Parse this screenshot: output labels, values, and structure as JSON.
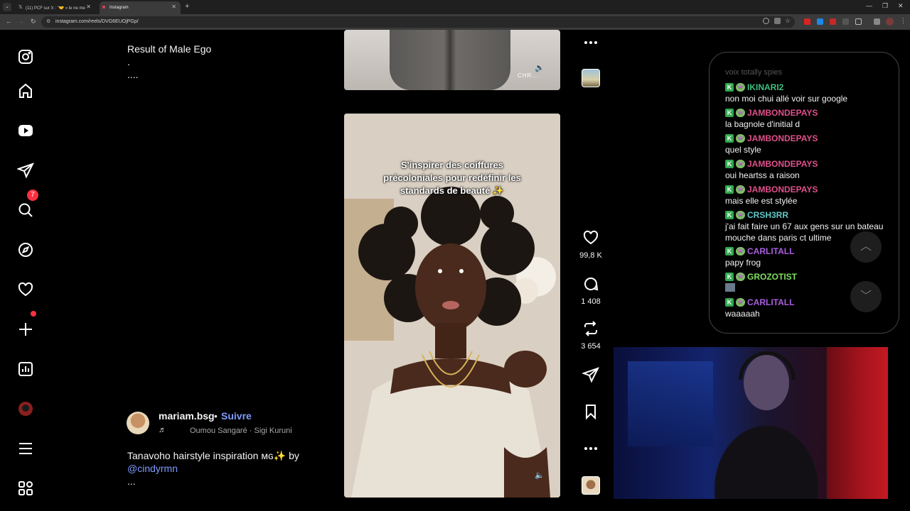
{
  "browser": {
    "tabs": [
      {
        "title": "(11) PCF sur X : \"🤝 « le ne me",
        "favicon": "x-icon"
      },
      {
        "title": "Instagram",
        "favicon": "instagram-icon",
        "active": true
      }
    ],
    "url": "instagram.com/reels/DVG6EUOjPGp/"
  },
  "nav": {
    "notifications_badge": "7",
    "items": [
      "instagram-logo",
      "home",
      "reels",
      "messages",
      "search",
      "explore",
      "notifications",
      "create",
      "dashboard",
      "profile",
      "more",
      "meta-apps"
    ]
  },
  "previous_reel": {
    "caption_line1": "Result of Male Ego",
    "caption_line2": ".",
    "caption_line3": "....",
    "brand_text": "CHR..."
  },
  "current_reel": {
    "overlay_text_line1": "S'inspirer des coiffures",
    "overlay_text_line2": "précoloniales pour redéfinir les",
    "overlay_text_line3": "standards de beauté ✨",
    "author": "mariam.bsg",
    "separator": "•",
    "follow_label": "Suivre",
    "music": "Oumou Sangaré · Sigi Kuruni",
    "caption_text": "Tanavoho hairstyle inspiration ᴍɢ✨ by",
    "caption_mention": "@cindyrmn",
    "caption_more": "...",
    "likes": "99,8 K",
    "comments": "1 408",
    "reposts": "3 654"
  },
  "chat": {
    "faded_text": "voix totally spies",
    "messages": [
      {
        "user": "IKINARI2",
        "color": "#3fbf7f",
        "text": "non moi chui allé voir sur google"
      },
      {
        "user": "JAMBONDEPAYS",
        "color": "#e0508a",
        "text": "la bagnole d'initial d"
      },
      {
        "user": "JAMBONDEPAYS",
        "color": "#e0508a",
        "text": "quel style"
      },
      {
        "user": "JAMBONDEPAYS",
        "color": "#e0508a",
        "text": "oui heartss a raison"
      },
      {
        "user": "JAMBONDEPAYS",
        "color": "#e0508a",
        "text": "mais elle est stylée"
      },
      {
        "user": "CRSH3RR",
        "color": "#5fc8c8",
        "text": "j'ai fait faire un 67 aux gens sur un bateau mouche dans paris ct ultime"
      },
      {
        "user": "CARLITALL",
        "color": "#a95fe0",
        "text": "papy frog"
      },
      {
        "user": "GROZOTIST",
        "color": "#7fe05f",
        "text": ""
      },
      {
        "user": "CARLITALL",
        "color": "#a95fe0",
        "text": "waaaaah"
      }
    ]
  }
}
